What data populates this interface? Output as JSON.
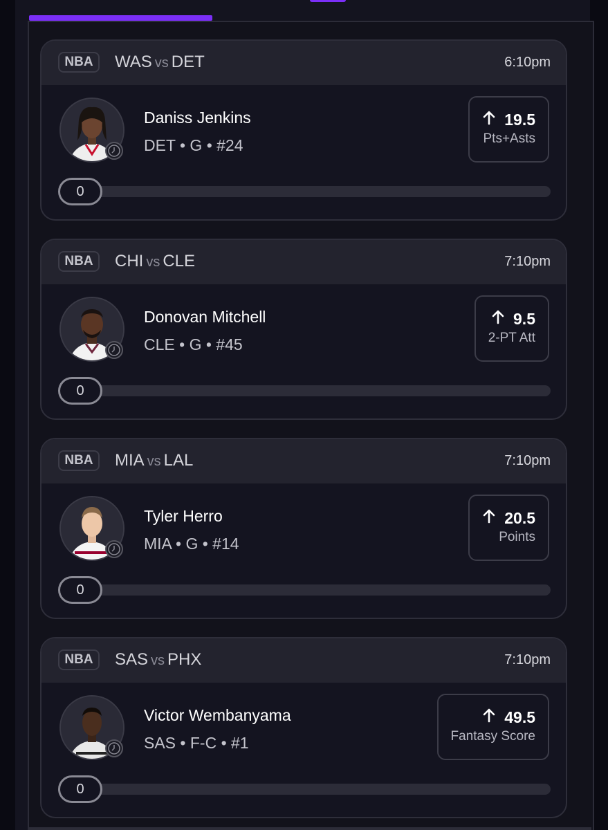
{
  "colors": {
    "background": "#141420",
    "card_header": "#23232e",
    "accent": "#7b2ff7",
    "text_primary": "#ffffff",
    "text_secondary": "#c4c4cc"
  },
  "icons": {
    "more_arrow": "arrow-up-icon",
    "status": "clock-icon"
  },
  "cards": [
    {
      "league": "NBA",
      "home_team": "WAS",
      "vs": "vs",
      "away_team": "DET",
      "time": "6:10pm",
      "player_name": "Daniss Jenkins",
      "player_meta": "DET • G • #24",
      "line_value": "19.5",
      "stat": "Pts+Asts",
      "progress_value": "0",
      "progress_fraction": 0
    },
    {
      "league": "NBA",
      "home_team": "CHI",
      "vs": "vs",
      "away_team": "CLE",
      "time": "7:10pm",
      "player_name": "Donovan Mitchell",
      "player_meta": "CLE • G • #45",
      "line_value": "9.5",
      "stat": "2-PT Att",
      "progress_value": "0",
      "progress_fraction": 0
    },
    {
      "league": "NBA",
      "home_team": "MIA",
      "vs": "vs",
      "away_team": "LAL",
      "time": "7:10pm",
      "player_name": "Tyler Herro",
      "player_meta": "MIA • G • #14",
      "line_value": "20.5",
      "stat": "Points",
      "progress_value": "0",
      "progress_fraction": 0
    },
    {
      "league": "NBA",
      "home_team": "SAS",
      "vs": "vs",
      "away_team": "PHX",
      "time": "7:10pm",
      "player_name": "Victor Wembanyama",
      "player_meta": "SAS • F-C • #1",
      "line_value": "49.5",
      "stat": "Fantasy Score",
      "progress_value": "0",
      "progress_fraction": 0
    }
  ]
}
